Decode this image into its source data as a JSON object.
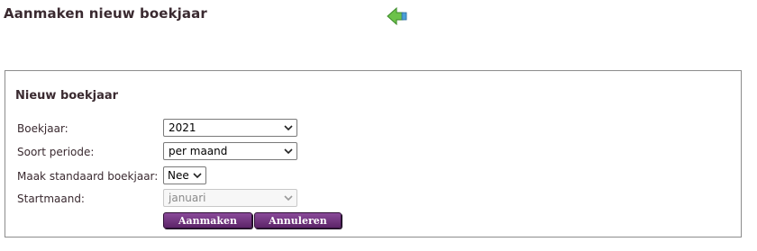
{
  "page": {
    "title": "Aanmaken nieuw boekjaar",
    "back_icon": "back-arrow-icon"
  },
  "form": {
    "title": "Nieuw boekjaar",
    "fields": {
      "boekjaar": {
        "label": "Boekjaar:",
        "value": "2021"
      },
      "soort_periode": {
        "label": "Soort periode:",
        "value": "per maand"
      },
      "standaard": {
        "label": "Maak standaard boekjaar:",
        "value": "Nee"
      },
      "startmaand": {
        "label": "Startmaand:",
        "value": "januari",
        "disabled": true
      }
    },
    "buttons": {
      "create": "Aanmaken",
      "cancel": "Annuleren"
    }
  },
  "colors": {
    "button": "#6b2f78",
    "text": "#3a2a30",
    "icon_green": "#6cc24a"
  }
}
